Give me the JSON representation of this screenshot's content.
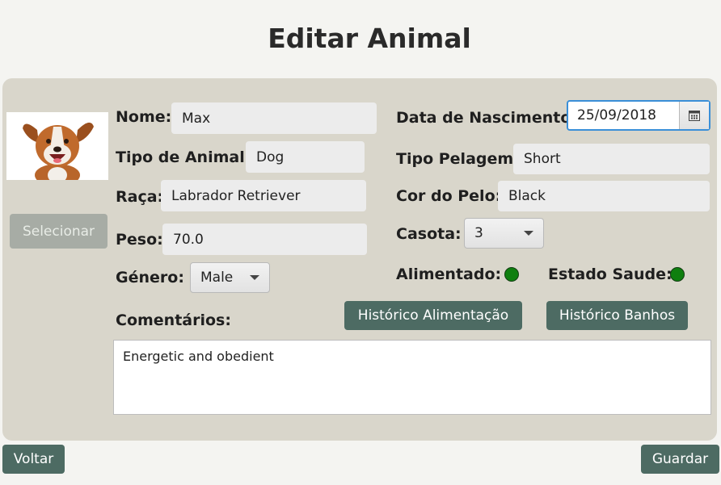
{
  "page": {
    "title": "Editar Animal"
  },
  "photo": {
    "alt_name": "dog-photo"
  },
  "buttons": {
    "select": "Selecionar",
    "feeding_history": "Histórico Alimentação",
    "bath_history": "Histórico Banhos",
    "back": "Voltar",
    "save": "Guardar"
  },
  "form": {
    "name_label": "Nome:",
    "name_value": "Max",
    "type_label": "Tipo de Animal:",
    "type_value": "Dog",
    "breed_label": "Raça:",
    "breed_value": "Labrador Retriever",
    "weight_label": "Peso:",
    "weight_value": "70.0",
    "gender_label": "Género:",
    "gender_value": "Male",
    "birth_label": "Data de Nascimento:",
    "birth_value": "25/09/2018",
    "coat_type_label": "Tipo Pelagem:",
    "coat_type_value": "Short",
    "coat_color_label": "Cor do Pelo:",
    "coat_color_value": "Black",
    "kennel_label": "Casota:",
    "kennel_value": "3",
    "fed_label": "Alimentado:",
    "fed_status_color": "#0f7f0f",
    "health_label": "Estado Saude:",
    "health_status_color": "#0f7f0f",
    "comments_label": "Comentários:",
    "comments_value": "Energetic and obedient"
  },
  "colors": {
    "accent_button": "#4d6b63",
    "panel": "#d9d6cb",
    "focus_border": "#3a8fd8"
  }
}
